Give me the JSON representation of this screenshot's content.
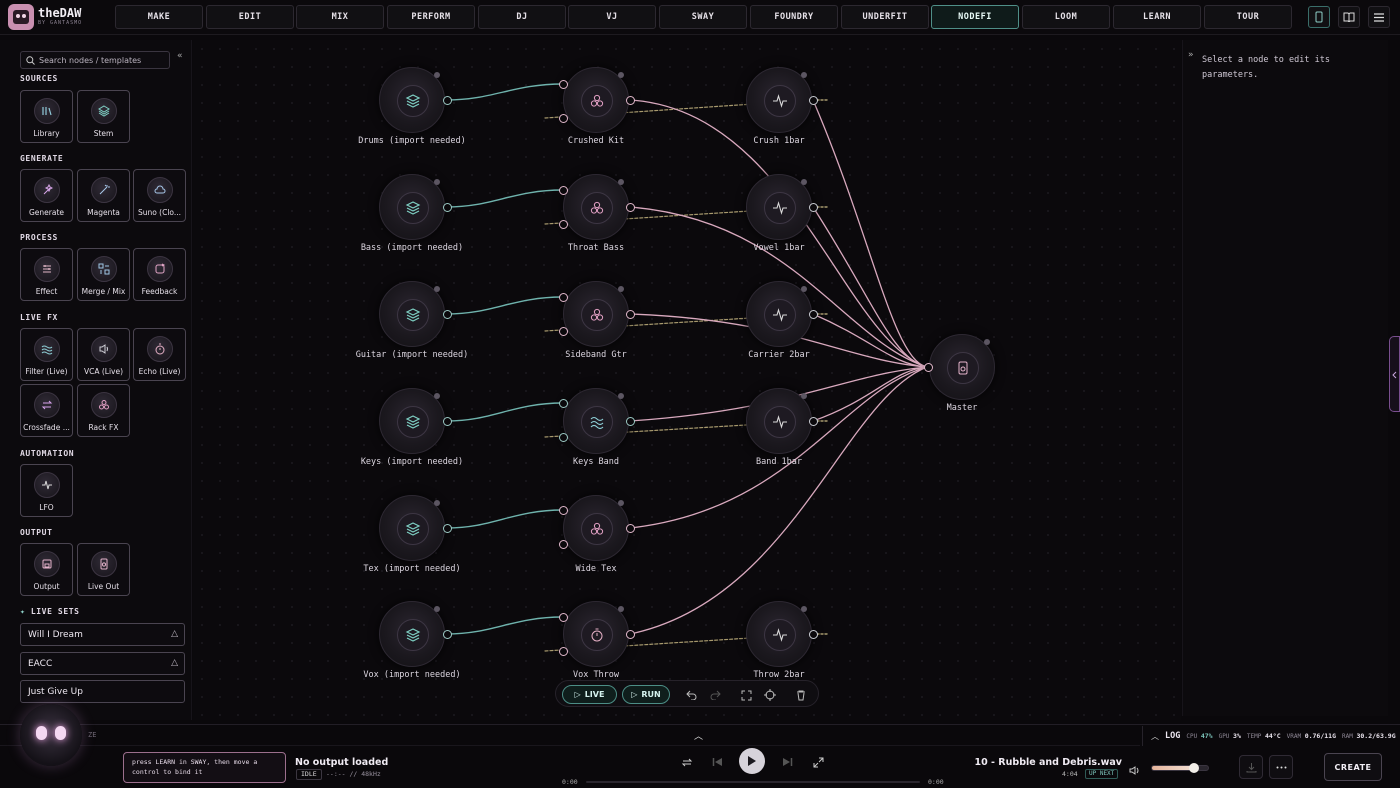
{
  "app": {
    "brand": "theDAW",
    "brand_sub": "BY GANTASMO"
  },
  "nav": {
    "tabs": [
      "MAKE",
      "EDIT",
      "MIX",
      "PERFORM",
      "DJ",
      "VJ",
      "SWAY",
      "FOUNDRY",
      "UNDERFIT",
      "NODEFI",
      "LOOM",
      "LEARN",
      "TOUR"
    ],
    "active": "NODEFI"
  },
  "sidebar": {
    "search_placeholder": "Search nodes / templates",
    "sections": {
      "sources": {
        "title": "SOURCES",
        "items": [
          "Library",
          "Stem"
        ]
      },
      "generate": {
        "title": "GENERATE",
        "items": [
          "Generate",
          "Magenta",
          "Suno (Clo..."
        ]
      },
      "process": {
        "title": "PROCESS",
        "items": [
          "Effect",
          "Merge / Mix",
          "Feedback"
        ]
      },
      "live_fx": {
        "title": "LIVE FX",
        "items": [
          "Filter (Live)",
          "VCA (Live)",
          "Echo (Live)",
          "Crossfade ...",
          "Rack FX"
        ]
      },
      "automation": {
        "title": "AUTOMATION",
        "items": [
          "LFO"
        ]
      },
      "output": {
        "title": "OUTPUT",
        "items": [
          "Output",
          "Live Out"
        ]
      }
    },
    "live_sets_title": "LIVE SETS",
    "live_sets": [
      "Will I Dream",
      "EACC",
      "Just Give Up"
    ]
  },
  "graph": {
    "sources": [
      "Drums (import needed)",
      "Bass (import needed)",
      "Guitar (import needed)",
      "Keys (import needed)",
      "Tex (import needed)",
      "Vox (import needed)"
    ],
    "processors": [
      "Crushed Kit",
      "Throat Bass",
      "Sideband Gtr",
      "Keys Band",
      "Wide Tex",
      "Vox Throw"
    ],
    "lfos": [
      "Crush 1bar",
      "Vowel 1bar",
      "Carrier 2bar",
      "Band 1bar",
      "Throw 2bar"
    ],
    "master": "Master"
  },
  "toolbar": {
    "live_label": "LIVE",
    "run_label": "RUN"
  },
  "inspector": {
    "placeholder": "Select a node to edit its parameters."
  },
  "status": {
    "log_label": "LOG",
    "cpu_label": "CPU",
    "cpu": "47%",
    "gpu_label": "GPU",
    "gpu": "3%",
    "temp_label": "TEMP",
    "temp": "44°C",
    "vram_label": "VRAM",
    "vram": "0.76/11G",
    "ram_label": "RAM",
    "ram": "30.2/63.9G",
    "left_stub": "ZE"
  },
  "player": {
    "hint": "press LEARN in SWAY, then move a control to bind it",
    "now_title": "No output loaded",
    "state": "IDLE",
    "format": "--:-- // 48kHz",
    "time_start": "0:00",
    "time_end": "0:00",
    "progress": 0,
    "track": "10 - Rubble and Debris.wav",
    "track_time": "4:04",
    "up_next": "UP NEXT",
    "volume": 0.75,
    "create_label": "CREATE"
  },
  "colors": {
    "accent_teal": "#4f8f88",
    "wire_teal": "#6fb3ad",
    "wire_pink": "#d9a9be",
    "hint_border": "#9c6f8d"
  }
}
